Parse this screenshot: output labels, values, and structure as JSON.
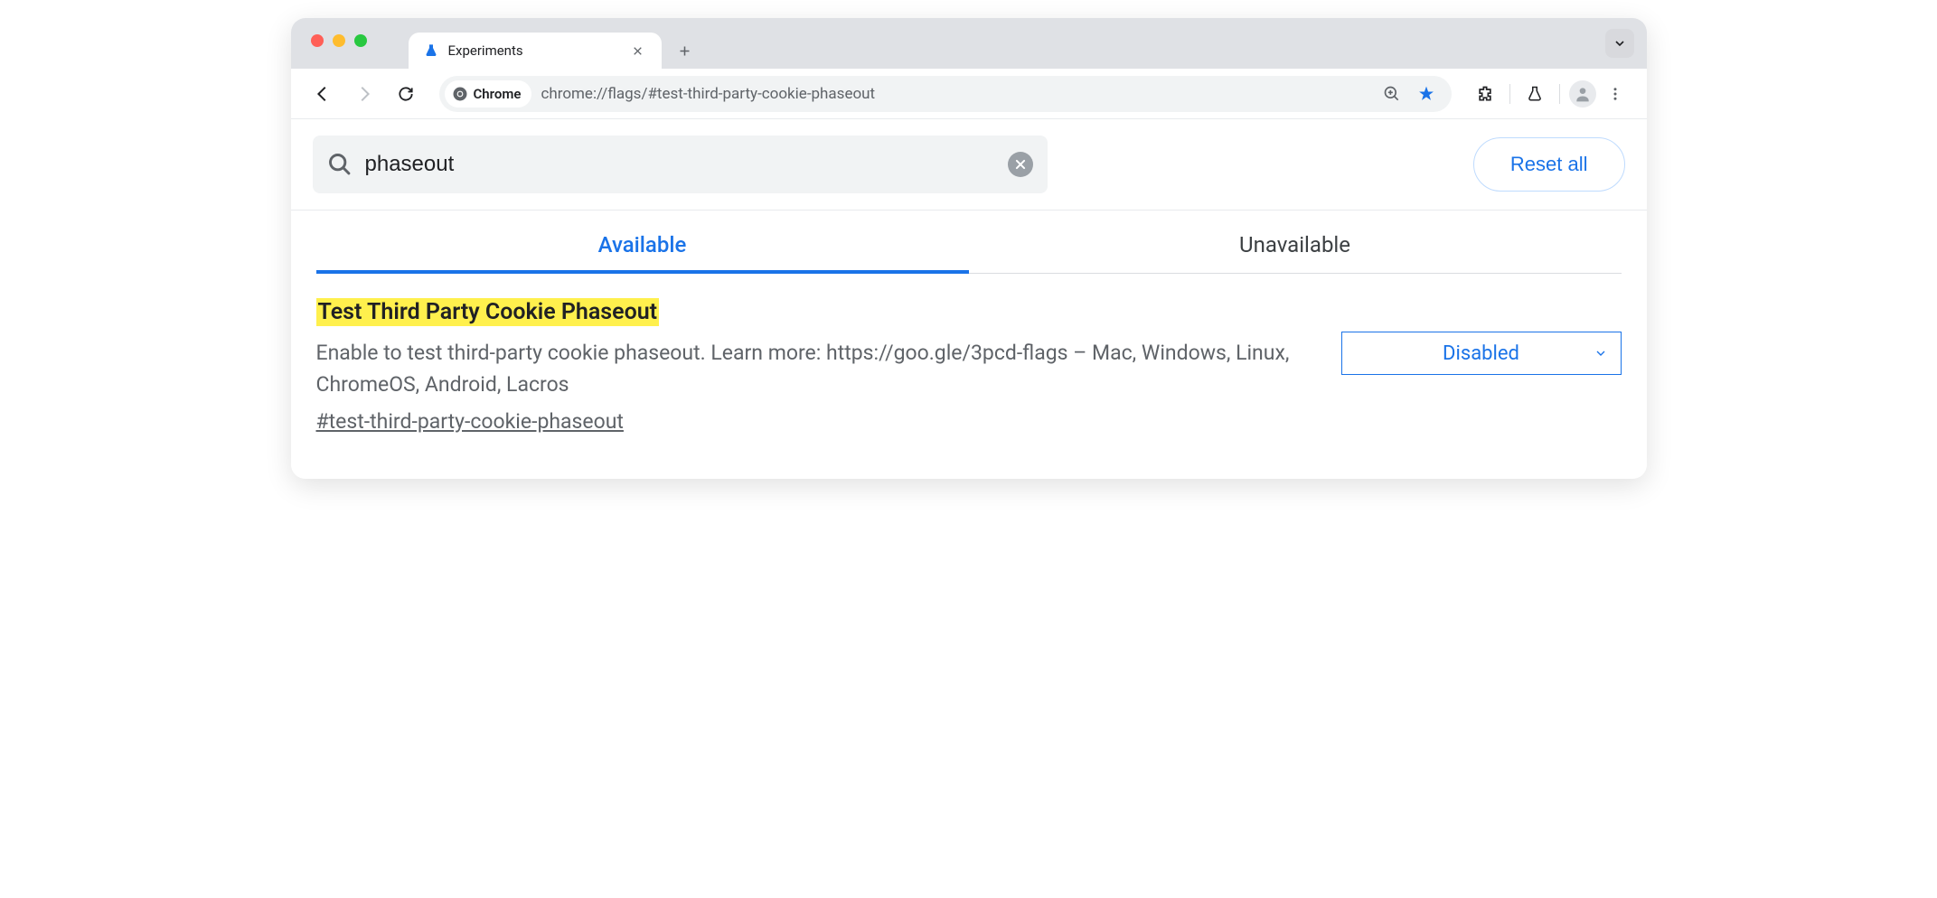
{
  "browser": {
    "tab_title": "Experiments",
    "address_chip": "Chrome",
    "url": "chrome://flags/#test-third-party-cookie-phaseout"
  },
  "search": {
    "value": "phaseout",
    "reset_label": "Reset all"
  },
  "tabs": {
    "available": "Available",
    "unavailable": "Unavailable"
  },
  "flag": {
    "title": "Test Third Party Cookie Phaseout",
    "description": "Enable to test third-party cookie phaseout. Learn more: https://goo.gle/3pcd-flags – Mac, Windows, Linux, ChromeOS, Android, Lacros",
    "anchor": "#test-third-party-cookie-phaseout",
    "selected": "Disabled"
  }
}
